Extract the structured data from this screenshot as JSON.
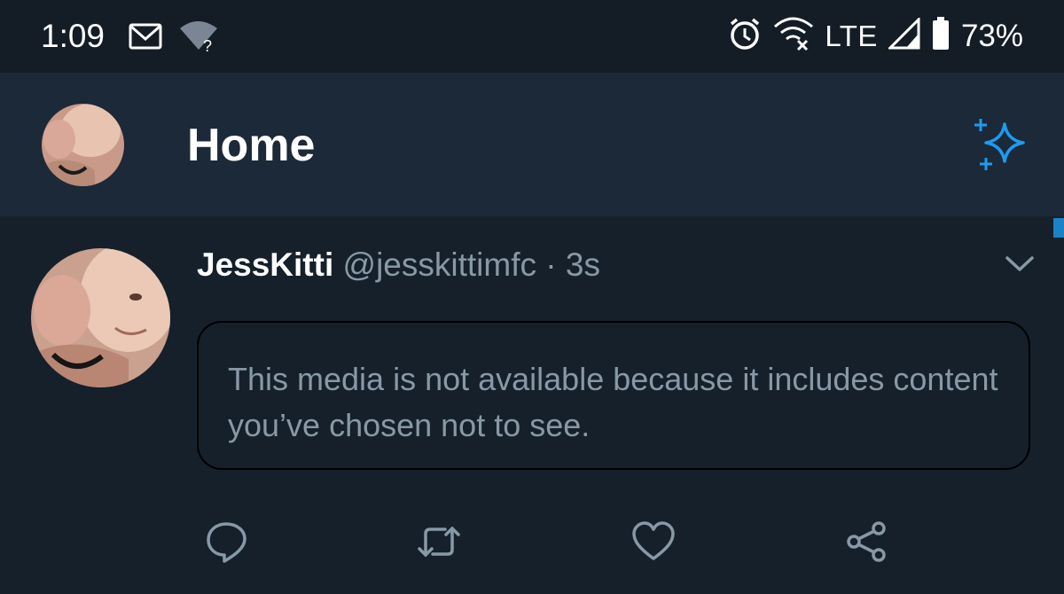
{
  "status_bar": {
    "time": "1:09",
    "network": "LTE",
    "battery": "73%",
    "icons": [
      "gmail-icon",
      "wifi-question-icon",
      "alarm-icon",
      "wifi-off-icon",
      "signal-icon",
      "battery-icon"
    ]
  },
  "header": {
    "title": "Home",
    "icons": [
      "avatar",
      "sparkle-icon"
    ]
  },
  "tweet": {
    "name": "JessKitti",
    "handle": "@jesskittimfc",
    "separator": " · ",
    "time": "3s",
    "media_notice": "This media is not available because it includes content you’ve chosen not to see.",
    "actions": [
      "reply-icon",
      "retweet-icon",
      "like-icon",
      "share-icon"
    ]
  },
  "colors": {
    "background": "#15202b",
    "header_bg": "#1c2938",
    "status_bg": "#141d26",
    "accent": "#1d9bf0",
    "secondary_text": "#8899a6"
  }
}
